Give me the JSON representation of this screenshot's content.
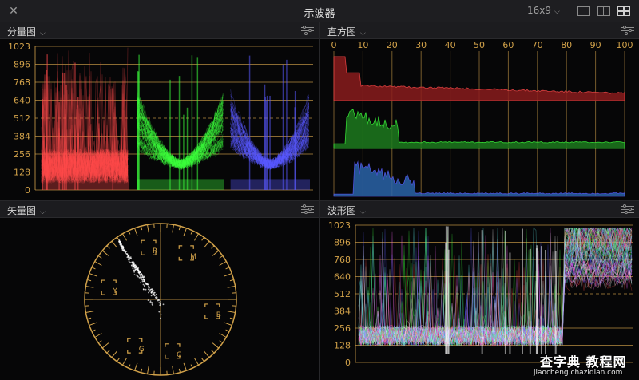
{
  "window": {
    "title": "示波器",
    "close_glyph": "✕",
    "aspect_ratio": "16x9"
  },
  "layout_buttons": [
    {
      "name": "single-view-icon",
      "active": false
    },
    {
      "name": "dual-view-icon",
      "active": false
    },
    {
      "name": "quad-view-icon",
      "active": true
    }
  ],
  "panels": {
    "parade": {
      "title": "分量图",
      "scale": [
        "1023",
        "896",
        "768",
        "640",
        "512",
        "384",
        "256",
        "128",
        "0"
      ]
    },
    "histogram": {
      "title": "直方图",
      "scale": [
        "0",
        "10",
        "20",
        "30",
        "40",
        "50",
        "60",
        "70",
        "80",
        "90",
        "100"
      ]
    },
    "vectorscope": {
      "title": "矢量图",
      "targets": [
        "R",
        "M",
        "B",
        "C",
        "G",
        "Y"
      ]
    },
    "waveform": {
      "title": "波形图",
      "scale": [
        "1023",
        "896",
        "768",
        "640",
        "512",
        "384",
        "256",
        "128",
        "0"
      ]
    }
  },
  "colors": {
    "accent": "#d2a24a",
    "red": "#ff4b4b",
    "green": "#3cff3c",
    "blue": "#5a5aff",
    "hist_red": "#8a1c1c",
    "hist_green": "#1d7a1d",
    "hist_blue": "#2a64a8"
  },
  "watermark": {
    "text": "查字典 教程网",
    "url": "jiaocheng.chazidian.com"
  }
}
